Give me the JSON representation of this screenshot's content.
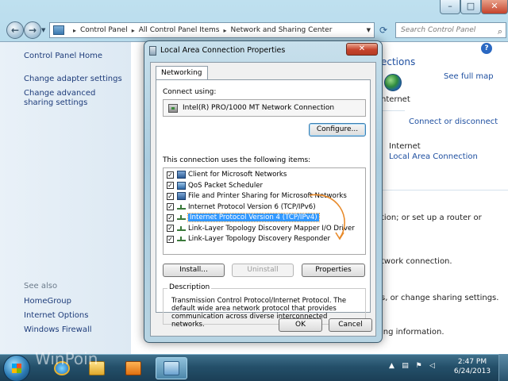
{
  "explorer": {
    "breadcrumb": [
      "Control Panel",
      "All Control Panel Items",
      "Network and Sharing Center"
    ],
    "search_placeholder": "Search Control Panel",
    "left_links": [
      "Control Panel Home",
      "Change adapter settings",
      "Change advanced sharing settings"
    ],
    "see_also_label": "See also",
    "see_also_links": [
      "HomeGroup",
      "Internet Options",
      "Windows Firewall"
    ],
    "right": {
      "title_fragment": "ections",
      "see_full_map": "See full map",
      "internet_label_1": "nternet",
      "connect_or_disconnect": "Connect or disconnect",
      "internet_label_2": "Internet",
      "local_area_connection": "Local Area Connection",
      "text_1": "tion; or set up a router or",
      "text_2": "twork connection.",
      "text_3": "s, or change sharing settings.",
      "text_4": "ing information."
    }
  },
  "dialog": {
    "title": "Local Area Connection Properties",
    "close_glyph": "✕",
    "tab_label": "Networking",
    "connect_using_label": "Connect using:",
    "adapter_name": "Intel(R) PRO/1000 MT Network Connection",
    "configure_button": "Configure...",
    "items_label": "This connection uses the following items:",
    "items": [
      {
        "label": "Client for Microsoft Networks",
        "checked": true,
        "icon": "client-icon"
      },
      {
        "label": "QoS Packet Scheduler",
        "checked": true,
        "icon": "qos-icon"
      },
      {
        "label": "File and Printer Sharing for Microsoft Networks",
        "checked": true,
        "icon": "share-icon"
      },
      {
        "label": "Internet Protocol Version 6 (TCP/IPv6)",
        "checked": true,
        "icon": "protocol-icon"
      },
      {
        "label": "Internet Protocol Version 4 (TCP/IPv4)",
        "checked": true,
        "icon": "protocol-icon",
        "selected": true
      },
      {
        "label": "Link-Layer Topology Discovery Mapper I/O Driver",
        "checked": true,
        "icon": "protocol-icon"
      },
      {
        "label": "Link-Layer Topology Discovery Responder",
        "checked": true,
        "icon": "protocol-icon"
      }
    ],
    "install_button": "Install...",
    "uninstall_button": "Uninstall",
    "properties_button": "Properties",
    "description_label": "Description",
    "description_text": "Transmission Control Protocol/Internet Protocol. The default wide area network protocol that provides communication across diverse interconnected networks.",
    "ok_button": "OK",
    "cancel_button": "Cancel"
  },
  "taskbar": {
    "watermark": "WinPoin",
    "time": "2:47 PM",
    "date": "6/24/2013"
  },
  "colors": {
    "accent_arrow": "#e88a2a",
    "selection": "#3399ff",
    "link": "#1e3c7a"
  }
}
